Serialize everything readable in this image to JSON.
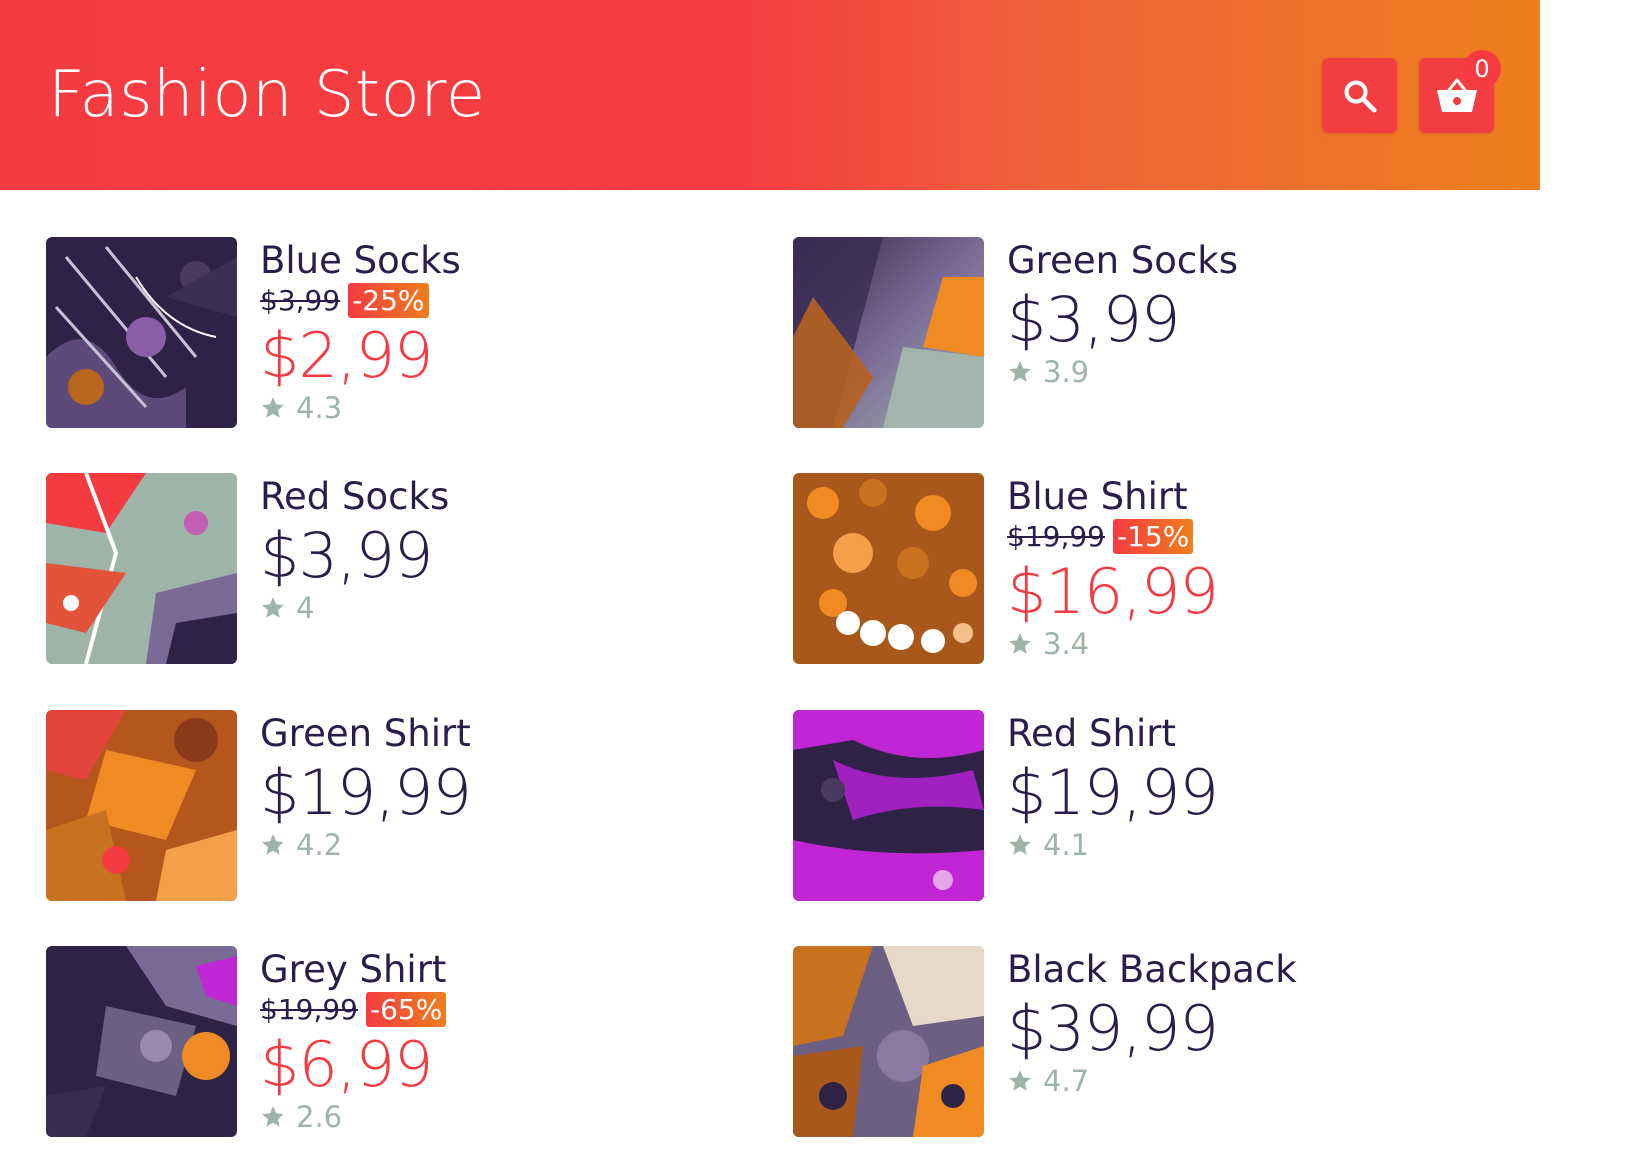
{
  "header": {
    "title": "Fashion Store",
    "cart_count": "0",
    "search_icon": "search-icon",
    "cart_icon": "basket-icon"
  },
  "colors": {
    "brand_red": "#f43b42",
    "brand_orange": "#ee7f1c",
    "text_dark": "#2b1d4a",
    "rating_grey": "#9fb4a8"
  },
  "products": [
    {
      "name": "Blue Socks",
      "old_price": "$3,99",
      "discount": "-25%",
      "price": "$2,99",
      "rating": "4.3"
    },
    {
      "name": "Green Socks",
      "price": "$3,99",
      "rating": "3.9"
    },
    {
      "name": "Red Socks",
      "price": "$3,99",
      "rating": "4"
    },
    {
      "name": "Blue Shirt",
      "old_price": "$19,99",
      "discount": "-15%",
      "price": "$16,99",
      "rating": "3.4"
    },
    {
      "name": "Green Shirt",
      "price": "$19,99",
      "rating": "4.2"
    },
    {
      "name": "Red Shirt",
      "price": "$19,99",
      "rating": "4.1"
    },
    {
      "name": "Grey Shirt",
      "old_price": "$19,99",
      "discount": "-65%",
      "price": "$6,99",
      "rating": "2.6"
    },
    {
      "name": "Black Backpack",
      "price": "$39,99",
      "rating": "4.7"
    }
  ]
}
